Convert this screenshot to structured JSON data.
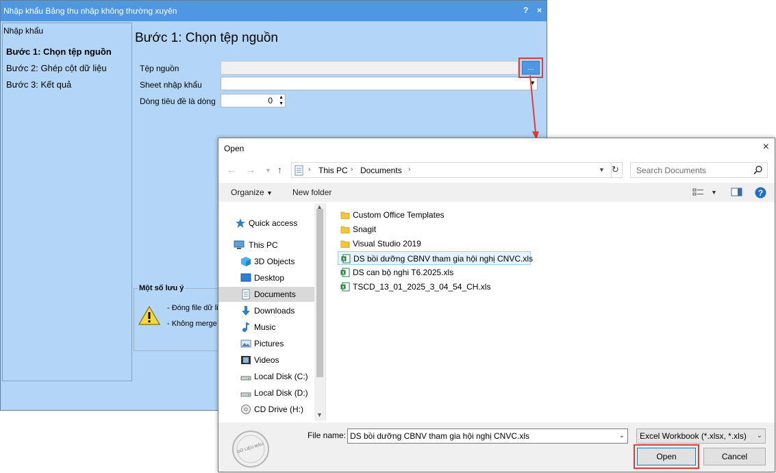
{
  "wizard": {
    "title": "Nhập khẩu Bảng thu nhập không thường xuyên",
    "help_label": "?",
    "close_label": "×",
    "sidebar_title": "Nhập khẩu",
    "steps": [
      {
        "label": "Bước 1: Chọn tệp nguồn",
        "active": true
      },
      {
        "label": "Bước 2: Ghép cột dữ liệu",
        "active": false
      },
      {
        "label": "Bước 3: Kết quả",
        "active": false
      }
    ],
    "main_title": "Bước 1: Chọn tệp nguồn",
    "fields": {
      "source_file_label": "Tệp nguồn",
      "source_file_value": "",
      "sheet_label": "Sheet nhập khẩu",
      "sheet_value": "",
      "header_row_label": "Dòng tiêu đề là dòng",
      "header_row_value": "0"
    },
    "browse_label": "...",
    "notes": {
      "title": "Một số lưu ý",
      "items": [
        "- Đóng file dữ li",
        "- Không merge"
      ]
    }
  },
  "open_dialog": {
    "title": "Open",
    "close_label": "×",
    "breadcrumb": [
      "This PC",
      "Documents"
    ],
    "search_placeholder": "Search Documents",
    "toolbar": {
      "organize_label": "Organize",
      "new_folder_label": "New folder"
    },
    "nav_items": [
      {
        "label": "Quick access",
        "icon": "star-icon"
      },
      {
        "label": "This PC",
        "icon": "computer-icon"
      },
      {
        "label": "3D Objects",
        "icon": "cube-icon"
      },
      {
        "label": "Desktop",
        "icon": "desktop-icon"
      },
      {
        "label": "Documents",
        "icon": "document-icon",
        "selected": true
      },
      {
        "label": "Downloads",
        "icon": "download-icon"
      },
      {
        "label": "Music",
        "icon": "music-icon"
      },
      {
        "label": "Pictures",
        "icon": "picture-icon"
      },
      {
        "label": "Videos",
        "icon": "video-icon"
      },
      {
        "label": "Local Disk (C:)",
        "icon": "drive-icon"
      },
      {
        "label": "Local Disk (D:)",
        "icon": "drive-icon"
      },
      {
        "label": "CD Drive (H:)",
        "icon": "cd-icon"
      }
    ],
    "files": [
      {
        "name": "Custom Office Templates",
        "type": "folder"
      },
      {
        "name": "Snagit",
        "type": "folder"
      },
      {
        "name": "Visual Studio 2019",
        "type": "folder"
      },
      {
        "name": "DS bồi dưỡng CBNV tham gia hội nghị CNVC.xls",
        "type": "excel",
        "selected": true
      },
      {
        "name": "DS can bộ nghi T6.2025.xls",
        "type": "excel"
      },
      {
        "name": "TSCD_13_01_2025_3_04_54_CH.xls",
        "type": "excel"
      }
    ],
    "file_name_label": "File name:",
    "file_name_value": "DS bồi dưỡng CBNV tham gia hội nghị CNVC.xls",
    "file_type_value": "Excel Workbook (*.xlsx, *.xls)",
    "open_label": "Open",
    "cancel_label": "Cancel",
    "watermark": "DỮ LIỆU MẪU"
  },
  "colors": {
    "wizard_bg": "#b3d6f7",
    "wizard_titlebar": "#4f97e3",
    "highlight_red": "#e23a3a",
    "selected_file_bg": "#e5f3ff"
  }
}
